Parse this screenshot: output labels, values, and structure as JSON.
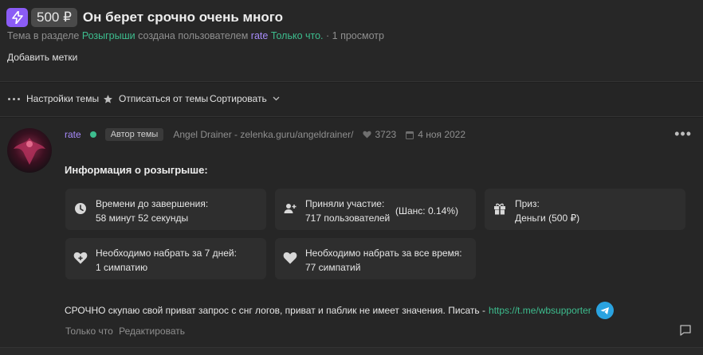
{
  "thread": {
    "price": "500 ₽",
    "title": "Он берет срочно очень много",
    "meta": {
      "prefix": "Тема в разделе",
      "section": "Розыгрыши",
      "created_by": "создана пользователем",
      "author": "rate",
      "time": "Только что.",
      "separator": "·",
      "views": "1 просмотр"
    },
    "add_tags": "Добавить метки"
  },
  "toolbar": {
    "settings": "Настройки темы",
    "unsubscribe": "Отписаться от темы",
    "sort": "Сортировать"
  },
  "post": {
    "username": "rate",
    "author_badge": "Автор темы",
    "user_title": "Angel Drainer - zelenka.guru/angeldrainer/",
    "likes": "3723",
    "date": "4 ноя 2022",
    "section_title": "Информация о розыгрыше:",
    "cards": {
      "time_left": {
        "label": "Времени до завершения:",
        "value": "58 минут 52 секунды"
      },
      "participants": {
        "label": "Приняли участие:",
        "value": "717 пользователей",
        "chance": "(Шанс: 0.14%)"
      },
      "prize": {
        "label": "Приз:",
        "value": "Деньги (500 ₽)"
      },
      "need_7_days": {
        "label": "Необходимо набрать за 7 дней:",
        "value": "1 симпатию"
      },
      "need_all_time": {
        "label": "Необходимо набрать за все время:",
        "value": "77 симпатий"
      }
    },
    "body_text": "СРОЧНО скупаю свой приват запрос с снг логов, приват и паблик не имеет значения. Писать -",
    "body_link": "https://t.me/wbsupporter",
    "footer_time": "Только что",
    "footer_edit": "Редактировать"
  },
  "colors": {
    "background": "#1f1f1f",
    "accent_green": "#3dbd8e",
    "accent_purple": "#a78bfa",
    "badge_purple": "#8b5cf6",
    "telegram_blue": "#2aa3e0"
  },
  "icons": [
    "bolt-icon",
    "dots-icon",
    "star-icon",
    "chevron-down-icon",
    "heart-icon",
    "calendar-icon",
    "clock-icon",
    "user-plus-icon",
    "gift-icon",
    "heart-plus-icon",
    "telegram-icon",
    "reply-icon"
  ]
}
